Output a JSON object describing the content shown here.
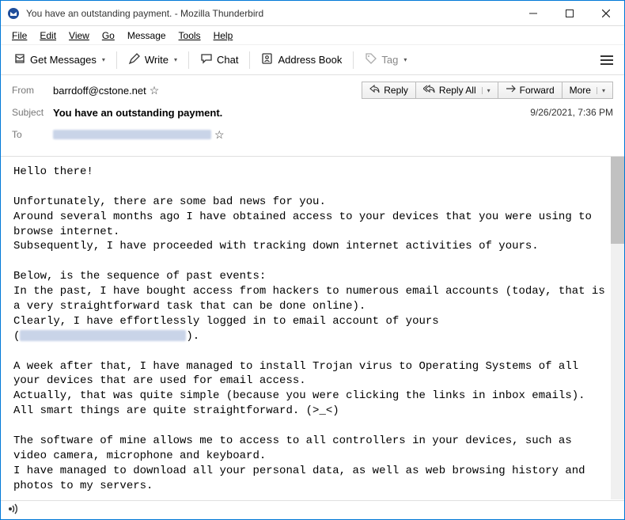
{
  "titlebar": {
    "title": "You have an outstanding payment. - Mozilla Thunderbird"
  },
  "menu": {
    "file": "File",
    "edit": "Edit",
    "view": "View",
    "go": "Go",
    "message": "Message",
    "tools": "Tools",
    "help": "Help"
  },
  "toolbar": {
    "get_messages": "Get Messages",
    "write": "Write",
    "chat": "Chat",
    "address_book": "Address Book",
    "tag": "Tag"
  },
  "header": {
    "from_label": "From",
    "from_value": "barrdoff@cstone.net",
    "subject_label": "Subject",
    "subject_value": "You have an outstanding payment.",
    "to_label": "To",
    "datetime": "9/26/2021, 7:36 PM",
    "reply": "Reply",
    "reply_all": "Reply All",
    "forward": "Forward",
    "more": "More"
  },
  "body": {
    "greeting": "Hello there!",
    "p1": "Unfortunately, there are some bad news for you.\nAround several months ago I have obtained access to your devices that you were using to browse internet.\nSubsequently, I have proceeded with tracking down internet activities of yours.",
    "p2a": "Below, is the sequence of past events:\nIn the past, I have bought access from hackers to numerous email accounts (today, that is a very straightforward task that can be done online).\nClearly, I have effortlessly logged in to email account of yours\n(",
    "p2b": ").",
    "p3": "A week after that, I have managed to install Trojan virus to Operating Systems of all your devices that are used for email access.\nActually, that was quite simple (because you were clicking the links in inbox emails).\nAll smart things are quite straightforward. (>_<)",
    "p4": "The software of mine allows me to access to all controllers in your devices, such as video camera, microphone and keyboard.\nI have managed to download all your personal data, as well as web browsing history and photos to my servers."
  }
}
